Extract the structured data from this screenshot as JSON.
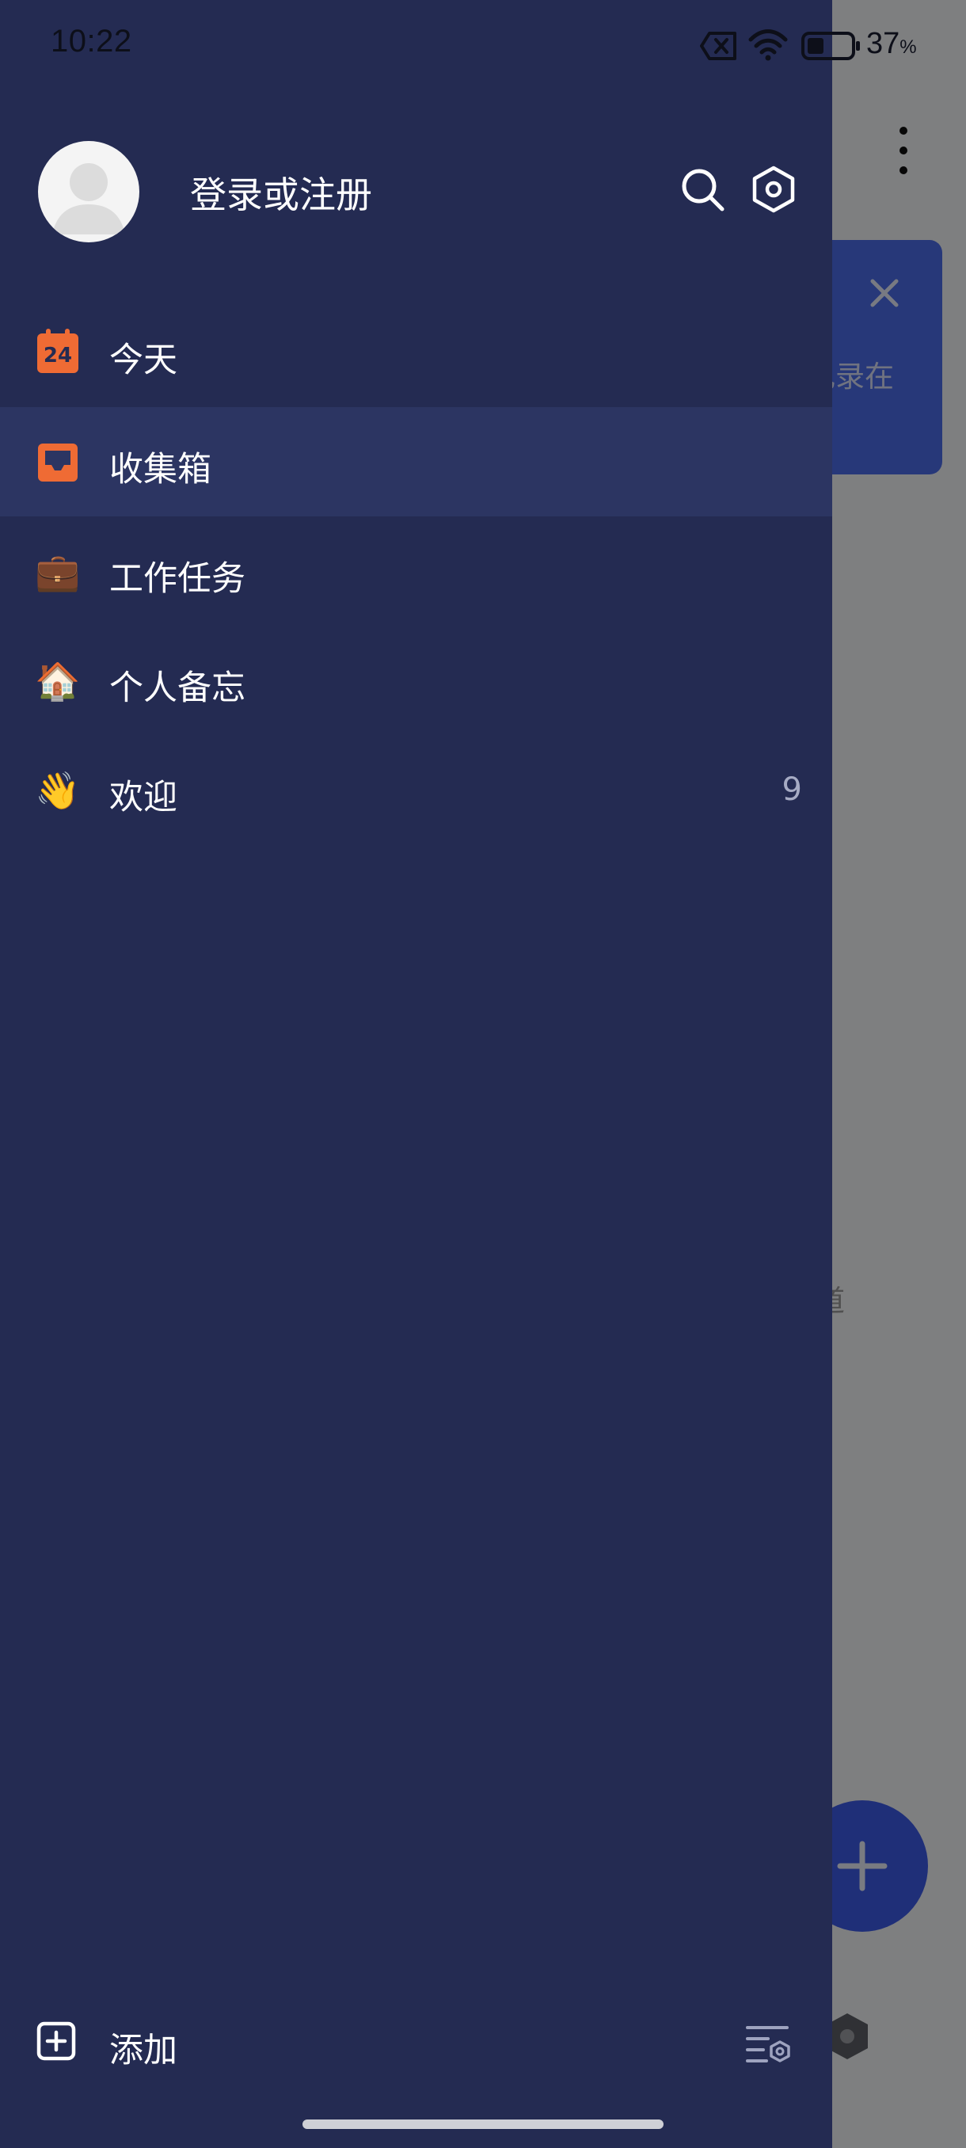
{
  "status_bar": {
    "time": "10:22",
    "battery_value": "37",
    "battery_unit": "%",
    "icons": [
      "sim-off-icon",
      "wifi-icon",
      "battery-icon"
    ]
  },
  "background": {
    "card_text": "记录在",
    "faint_text": "道"
  },
  "drawer": {
    "profile": {
      "login_label": "登录或注册",
      "icons": [
        "avatar",
        "search-icon",
        "settings-hexagon-icon"
      ]
    },
    "nav_items": [
      {
        "label": "今天",
        "icon": "calendar-today-icon",
        "icon_text": "24",
        "count": "",
        "active": false
      },
      {
        "label": "收集箱",
        "icon": "inbox-icon",
        "count": "",
        "active": true
      },
      {
        "label": "工作任务",
        "icon": "briefcase-icon",
        "emoji": "💼",
        "count": "",
        "active": false
      },
      {
        "label": "个人备忘",
        "icon": "house-icon",
        "emoji": "🏠",
        "count": "",
        "active": false
      },
      {
        "label": "欢迎",
        "icon": "waving-hand-icon",
        "emoji": "👋",
        "count": "9",
        "active": false
      }
    ],
    "bottom": {
      "add_label": "添加",
      "icons": [
        "add-square-icon",
        "list-settings-icon"
      ]
    }
  },
  "colors": {
    "drawer_bg": "#242b52",
    "active_item_bg": "#2c3562",
    "accent_orange": "#ef6b34",
    "fab_blue": "#3d5ae6"
  }
}
